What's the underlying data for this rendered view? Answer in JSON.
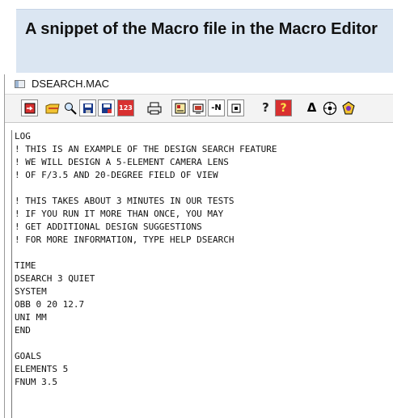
{
  "caption": "A snippet of the Macro file in the Macro Editor",
  "window": {
    "title": "DSEARCH.MAC"
  },
  "toolbar": {
    "icons": [
      "save-icon",
      "open-icon",
      "find-icon",
      "disk-icon",
      "disk-save-icon",
      "number-icon",
      "print-icon",
      "macro-icon",
      "screen-icon",
      "minus-n-icon",
      "frame-icon",
      "help-icon",
      "help-box-icon",
      "triangle-icon",
      "target-icon",
      "badge-icon"
    ],
    "number_label": "123",
    "minus_n_label": "-N",
    "help_label": "?",
    "triangle_label": "Δ"
  },
  "code_lines": [
    "LOG",
    "! THIS IS AN EXAMPLE OF THE DESIGN SEARCH FEATURE",
    "! WE WILL DESIGN A 5-ELEMENT CAMERA LENS",
    "! OF F/3.5 AND 20-DEGREE FIELD OF VIEW",
    "",
    "! THIS TAKES ABOUT 3 MINUTES IN OUR TESTS",
    "! IF YOU RUN IT MORE THAN ONCE, YOU MAY",
    "! GET ADDITIONAL DESIGN SUGGESTIONS",
    "! FOR MORE INFORMATION, TYPE HELP DSEARCH",
    "",
    "TIME",
    "DSEARCH 3 QUIET",
    "SYSTEM",
    "OBB 0 20 12.7",
    "UNI MM",
    "END",
    "",
    "GOALS",
    "ELEMENTS 5",
    "FNUM 3.5"
  ]
}
